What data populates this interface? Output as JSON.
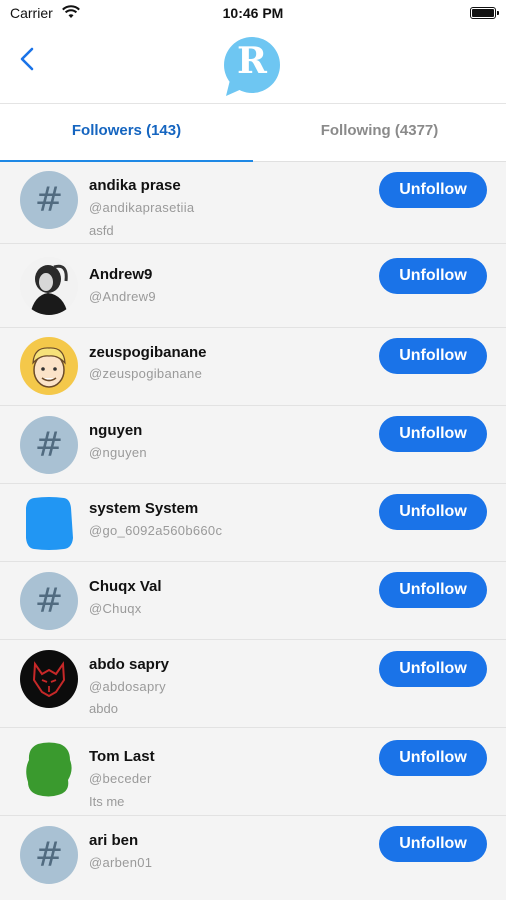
{
  "status_bar": {
    "carrier": "Carrier",
    "time": "10:46 PM",
    "icons": [
      "wifi-icon",
      "battery-icon"
    ]
  },
  "nav": {
    "back_icon": "chevron-left-icon",
    "logo_letter": "R",
    "logo_color": "#6ec6f2"
  },
  "tabs": [
    {
      "label": "Followers (143)",
      "active": true
    },
    {
      "label": "Following (4377)",
      "active": false
    }
  ],
  "colors": {
    "accent": "#1a73e8",
    "active_tab": "#1565c0",
    "inactive_tab": "#8a8a8a"
  },
  "users": [
    {
      "name": "andika prase",
      "handle": "@andikaprasetiia",
      "bio": "asfd",
      "avatar": "hashtag"
    },
    {
      "name": "Andrew9",
      "handle": "@Andrew9",
      "bio": "",
      "avatar": "photo-person-bw"
    },
    {
      "name": "zeuspogibanane",
      "handle": "@zeuspogibanane",
      "bio": "",
      "avatar": "cartoon-face"
    },
    {
      "name": "nguyen",
      "handle": "@nguyen",
      "bio": "",
      "avatar": "hashtag"
    },
    {
      "name": "system System",
      "handle": "@go_6092a560b660c",
      "bio": "",
      "avatar": "blue-square"
    },
    {
      "name": "Chuqx Val",
      "handle": "@Chuqx",
      "bio": "",
      "avatar": "hashtag"
    },
    {
      "name": "abdo sapry",
      "handle": "@abdosapry",
      "bio": "abdo",
      "avatar": "red-wolf"
    },
    {
      "name": "Tom Last",
      "handle": "@beceder",
      "bio": "Its me",
      "avatar": "green-blob"
    },
    {
      "name": "ari ben",
      "handle": "@arben01",
      "bio": "",
      "avatar": "hashtag"
    }
  ],
  "button_label": "Unfollow"
}
